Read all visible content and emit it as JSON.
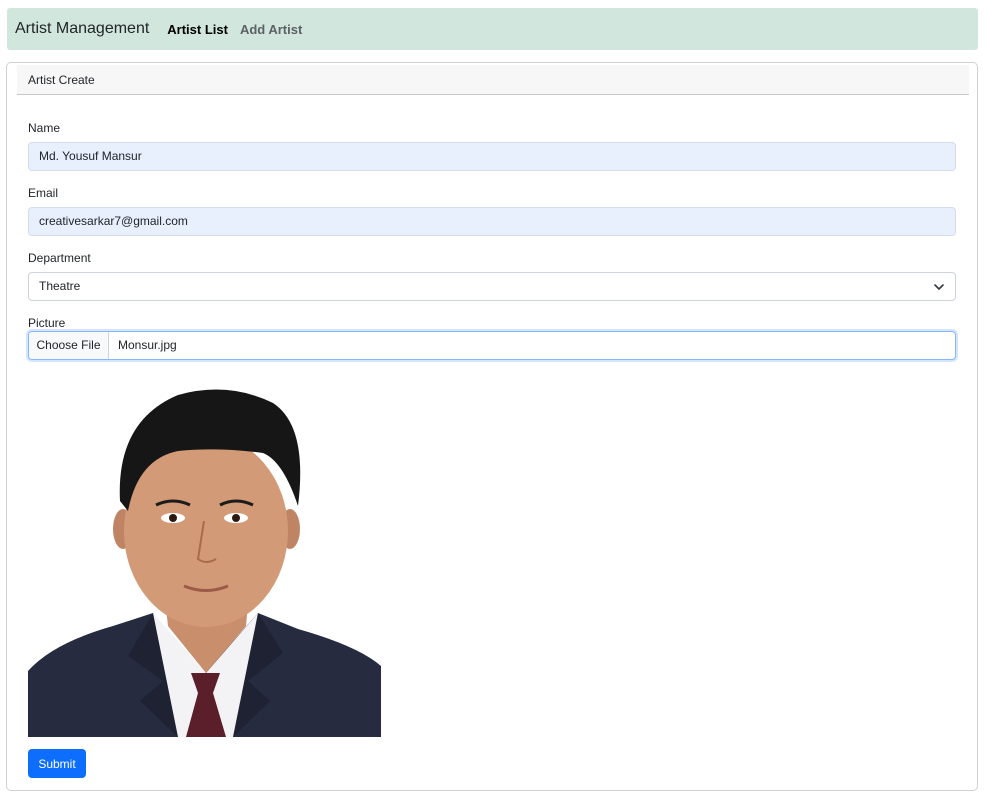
{
  "navbar": {
    "brand": "Artist Management",
    "links": [
      {
        "label": "Artist List",
        "active": true
      },
      {
        "label": "Add Artist",
        "active": false
      }
    ]
  },
  "card": {
    "header": "Artist Create",
    "fields": {
      "name": {
        "label": "Name",
        "value": "Md. Yousuf Mansur"
      },
      "email": {
        "label": "Email",
        "value": "creativesarkar7@gmail.com"
      },
      "department": {
        "label": "Department",
        "value": "Theatre"
      },
      "picture": {
        "label": "Picture",
        "button": "Choose File",
        "file_name": "Monsur.jpg"
      }
    },
    "preview_image": "artist-photo-preview",
    "submit_label": "Submit"
  },
  "colors": {
    "navbar_bg": "#d1e7dd",
    "autofill_bg": "#e8f0fe",
    "primary": "#0d6efd"
  },
  "icons": {
    "select_arrow": "chevron-down-icon"
  }
}
